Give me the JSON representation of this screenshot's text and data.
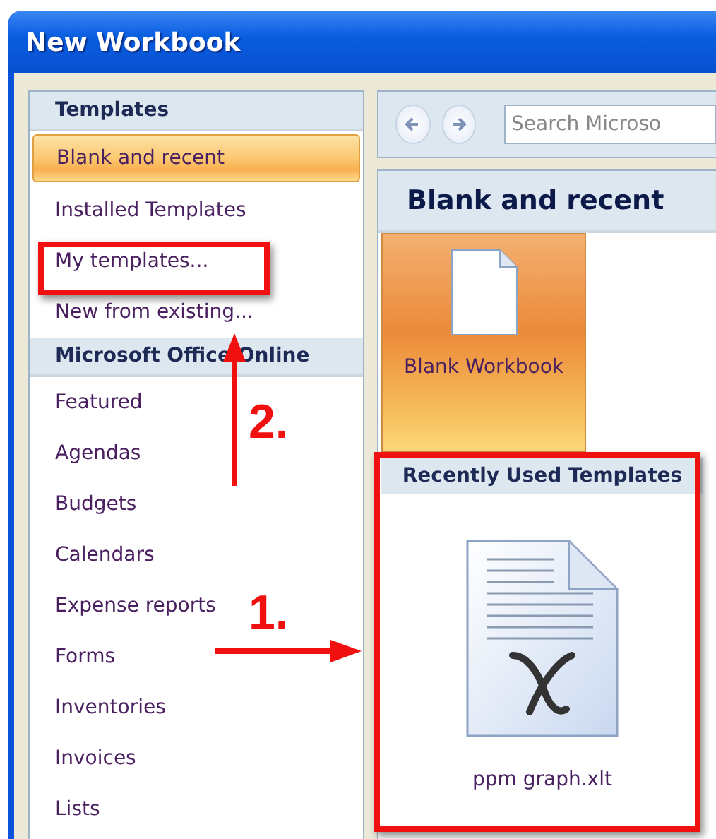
{
  "window": {
    "title": "New Workbook"
  },
  "sidebar": {
    "sections": [
      {
        "title": "Templates",
        "items": [
          {
            "label": "Blank and recent",
            "selected": true
          },
          {
            "label": "Installed Templates",
            "selected": false
          },
          {
            "label": "My templates...",
            "selected": false
          },
          {
            "label": "New from existing...",
            "selected": false
          }
        ]
      },
      {
        "title": "Microsoft Office Online",
        "items": [
          {
            "label": "Featured",
            "selected": false
          },
          {
            "label": "Agendas",
            "selected": false
          },
          {
            "label": "Budgets",
            "selected": false
          },
          {
            "label": "Calendars",
            "selected": false
          },
          {
            "label": "Expense reports",
            "selected": false
          },
          {
            "label": "Forms",
            "selected": false
          },
          {
            "label": "Inventories",
            "selected": false
          },
          {
            "label": "Invoices",
            "selected": false
          },
          {
            "label": "Lists",
            "selected": false
          }
        ]
      }
    ]
  },
  "search": {
    "placeholder": "Search Microso"
  },
  "content": {
    "heading": "Blank and recent",
    "tiles": [
      {
        "label": "Blank Workbook",
        "selected": true
      }
    ],
    "recent": {
      "title": "Recently Used Templates",
      "files": [
        {
          "label": "ppm graph.xlt"
        }
      ]
    }
  },
  "annotations": [
    {
      "label": "2."
    },
    {
      "label": "1."
    }
  ]
}
